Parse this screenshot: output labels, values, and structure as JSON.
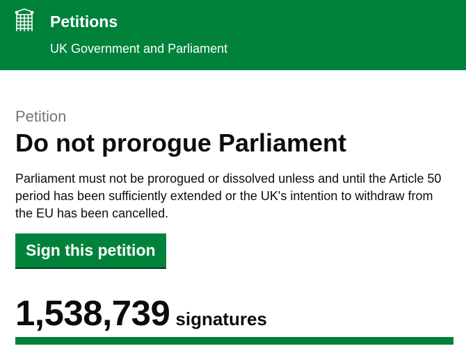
{
  "header": {
    "title": "Petitions",
    "subtitle": "UK Government and Parliament",
    "logo_icon": "portcullis-icon",
    "background_color": "#00823b"
  },
  "petition": {
    "caption": "Petition",
    "title": "Do not prorogue Parliament",
    "description": "Parliament must not be prorogued or dissolved unless and until the Article 50 period has been sufficiently extended or the UK's intention to withdraw from the EU has been cancelled.",
    "sign_button_label": "Sign this petition",
    "signature_count": "1,538,739",
    "signature_label": "signatures",
    "progress_fraction": 1.0
  },
  "colors": {
    "accent": "#00823b",
    "text": "#0b0c0c",
    "secondary_text": "#6f777b"
  }
}
